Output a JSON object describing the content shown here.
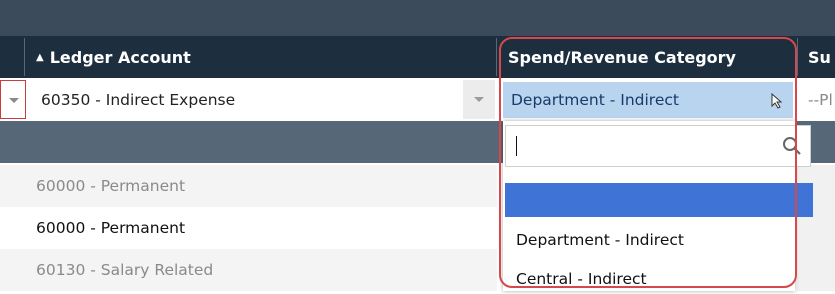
{
  "header": {
    "ledger_account_label": "Ledger Account",
    "sort_indicator": "▲",
    "spend_revenue_label": "Spend/Revenue Category",
    "next_col_label": "Su"
  },
  "row": {
    "ledger_value": "60350 - Indirect Expense",
    "category_value": "Department - Indirect",
    "next_placeholder": "--Pl"
  },
  "ledger_list": [
    {
      "label": "60000 - Permanent",
      "muted": true
    },
    {
      "label": "60000 - Permanent",
      "muted": false
    },
    {
      "label": "60130 - Salary Related",
      "muted": true
    }
  ],
  "dropdown": {
    "search_value": "",
    "options": [
      "Department - Indirect",
      "Central - Indirect"
    ]
  },
  "colors": {
    "header_bg": "#1d2e3e",
    "band_bg": "#566777",
    "selected_cell_bg": "#b8d4ee",
    "highlight_bg": "#3f73d6",
    "annotation_red": "#d94848"
  }
}
